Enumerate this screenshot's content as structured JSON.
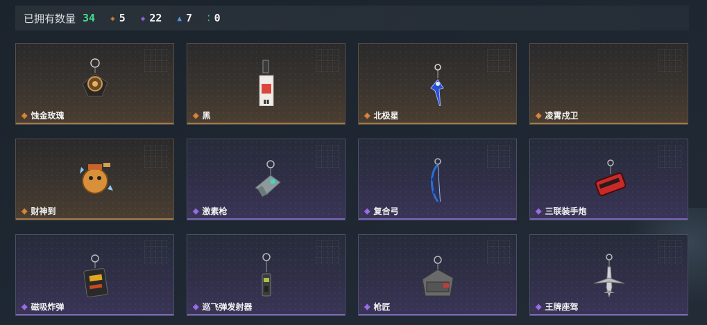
{
  "header": {
    "title": "已拥有数量",
    "total": "34",
    "stats": [
      {
        "icon": "diamond-orange-icon",
        "value": "5"
      },
      {
        "icon": "diamond-purple-icon",
        "value": "22"
      },
      {
        "icon": "diamond-blue-icon",
        "value": "7"
      },
      {
        "icon": "diamond-green-icon",
        "value": "0"
      }
    ]
  },
  "items": [
    {
      "name": "蚀金玫瑰",
      "rarity": "gold",
      "icon": "rose-pendant-icon"
    },
    {
      "name": "黑",
      "rarity": "gold",
      "icon": "black-tag-icon"
    },
    {
      "name": "北极星",
      "rarity": "gold",
      "icon": "polaris-charm-icon"
    },
    {
      "name": "凌霄戍卫",
      "rarity": "gold",
      "icon": "empty-slot-icon"
    },
    {
      "name": "财神到",
      "rarity": "gold",
      "icon": "fortune-god-icon"
    },
    {
      "name": "激素枪",
      "rarity": "purple",
      "icon": "stim-gun-icon"
    },
    {
      "name": "复合弓",
      "rarity": "purple",
      "icon": "compound-bow-icon"
    },
    {
      "name": "三联装手炮",
      "rarity": "purple",
      "icon": "triple-cannon-icon"
    },
    {
      "name": "磁吸炸弹",
      "rarity": "purple",
      "icon": "magnetic-bomb-icon"
    },
    {
      "name": "巡飞弹发射器",
      "rarity": "purple",
      "icon": "loitering-launcher-icon"
    },
    {
      "name": "枪匠",
      "rarity": "purple",
      "icon": "gunsmith-case-icon"
    },
    {
      "name": "王牌座驾",
      "rarity": "purple",
      "icon": "ace-jet-icon"
    }
  ],
  "colors": {
    "gold": "#e0883a",
    "purple": "#a26ef0",
    "total": "#3fe08a"
  }
}
